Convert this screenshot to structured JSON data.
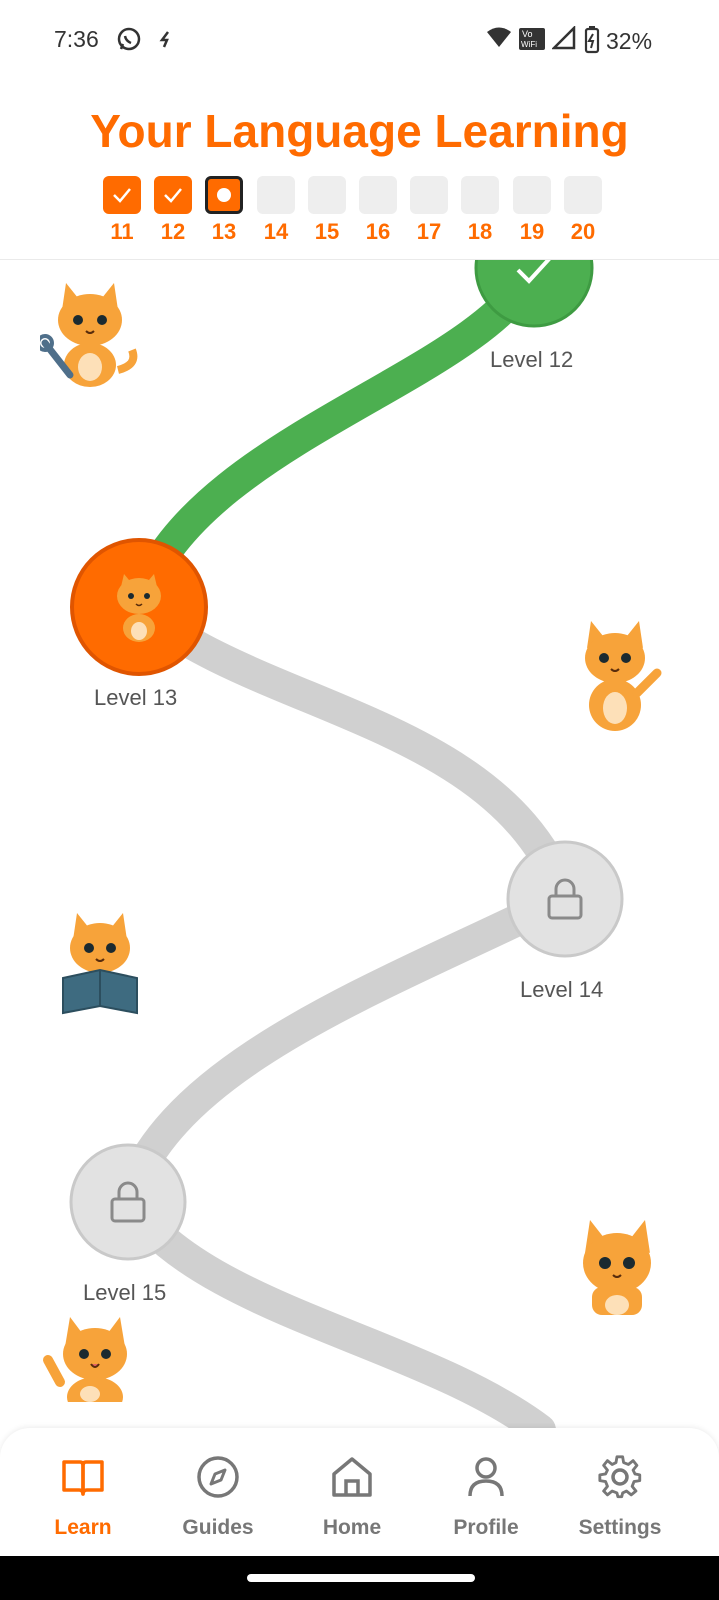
{
  "status_bar": {
    "time": "7:36",
    "battery": "32%"
  },
  "title": "Your Language Learning",
  "progress": [
    {
      "num": "11",
      "state": "done"
    },
    {
      "num": "12",
      "state": "done"
    },
    {
      "num": "13",
      "state": "current"
    },
    {
      "num": "14",
      "state": "locked"
    },
    {
      "num": "15",
      "state": "locked"
    },
    {
      "num": "16",
      "state": "locked"
    },
    {
      "num": "17",
      "state": "locked"
    },
    {
      "num": "18",
      "state": "locked"
    },
    {
      "num": "19",
      "state": "locked"
    },
    {
      "num": "20",
      "state": "locked"
    }
  ],
  "levels": [
    {
      "label": "Level 12",
      "state": "completed"
    },
    {
      "label": "Level 13",
      "state": "current"
    },
    {
      "label": "Level 14",
      "state": "locked"
    },
    {
      "label": "Level 15",
      "state": "locked"
    }
  ],
  "nav": [
    {
      "label": "Learn",
      "icon": "book-icon",
      "active": true
    },
    {
      "label": "Guides",
      "icon": "compass-icon",
      "active": false
    },
    {
      "label": "Home",
      "icon": "home-icon",
      "active": false
    },
    {
      "label": "Profile",
      "icon": "person-icon",
      "active": false
    },
    {
      "label": "Settings",
      "icon": "gear-icon",
      "active": false
    }
  ],
  "colors": {
    "accent": "#FF6B00",
    "completed": "#4CAF50",
    "locked": "#E0E0E0"
  }
}
